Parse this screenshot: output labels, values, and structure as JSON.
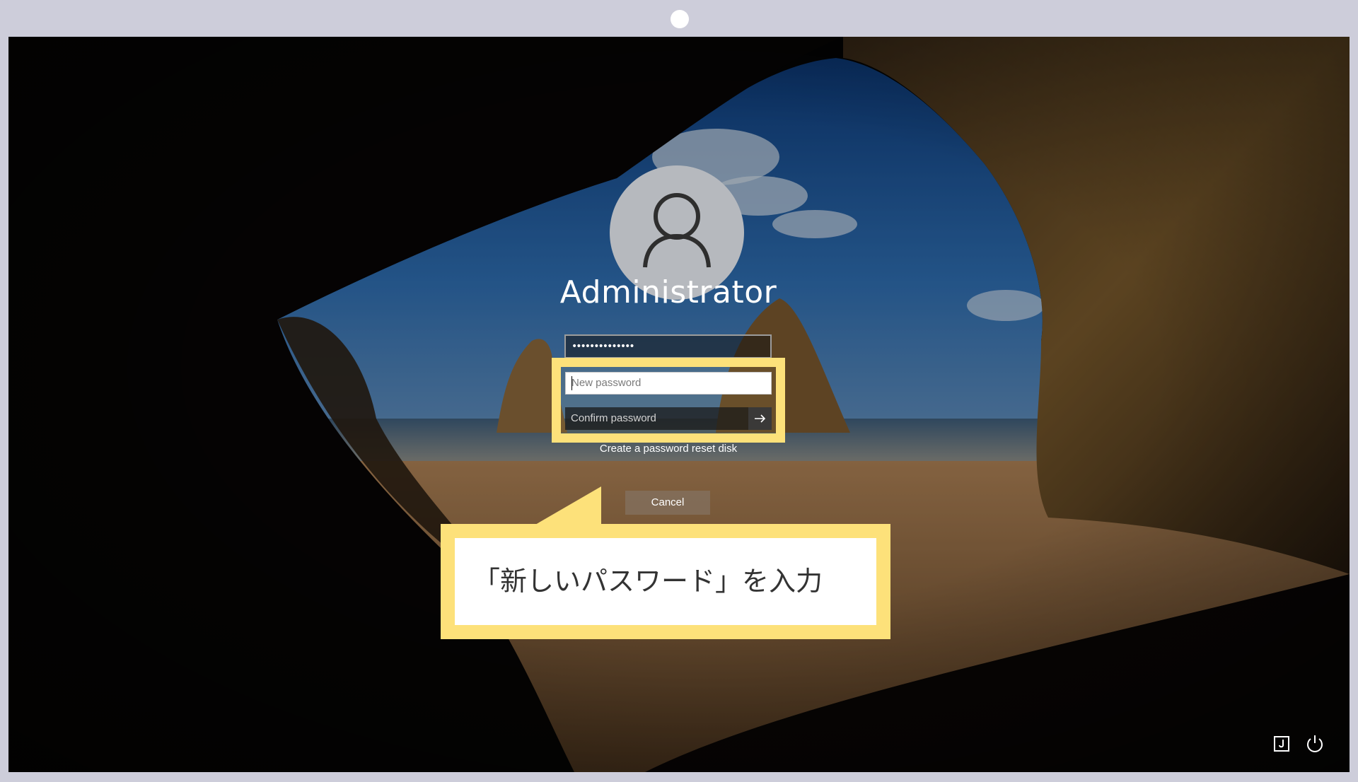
{
  "device": {
    "frame_color": "#cdcdda",
    "camera_icon": "camera-dot"
  },
  "login": {
    "avatar_icon": "user-icon",
    "username": "Administrator",
    "old_password_mask": "••••••••••••••",
    "new_password_placeholder": "New password",
    "confirm_password_placeholder": "Confirm password",
    "submit_icon": "arrow-right-icon",
    "reset_link": "Create a password reset disk",
    "cancel_label": "Cancel"
  },
  "annotation": {
    "callout_text": "「新しいパスワード」を入力",
    "highlight_color": "#fde17a"
  },
  "system_tray": {
    "accessibility_icon": "ease-of-access-icon",
    "power_icon": "power-icon"
  }
}
